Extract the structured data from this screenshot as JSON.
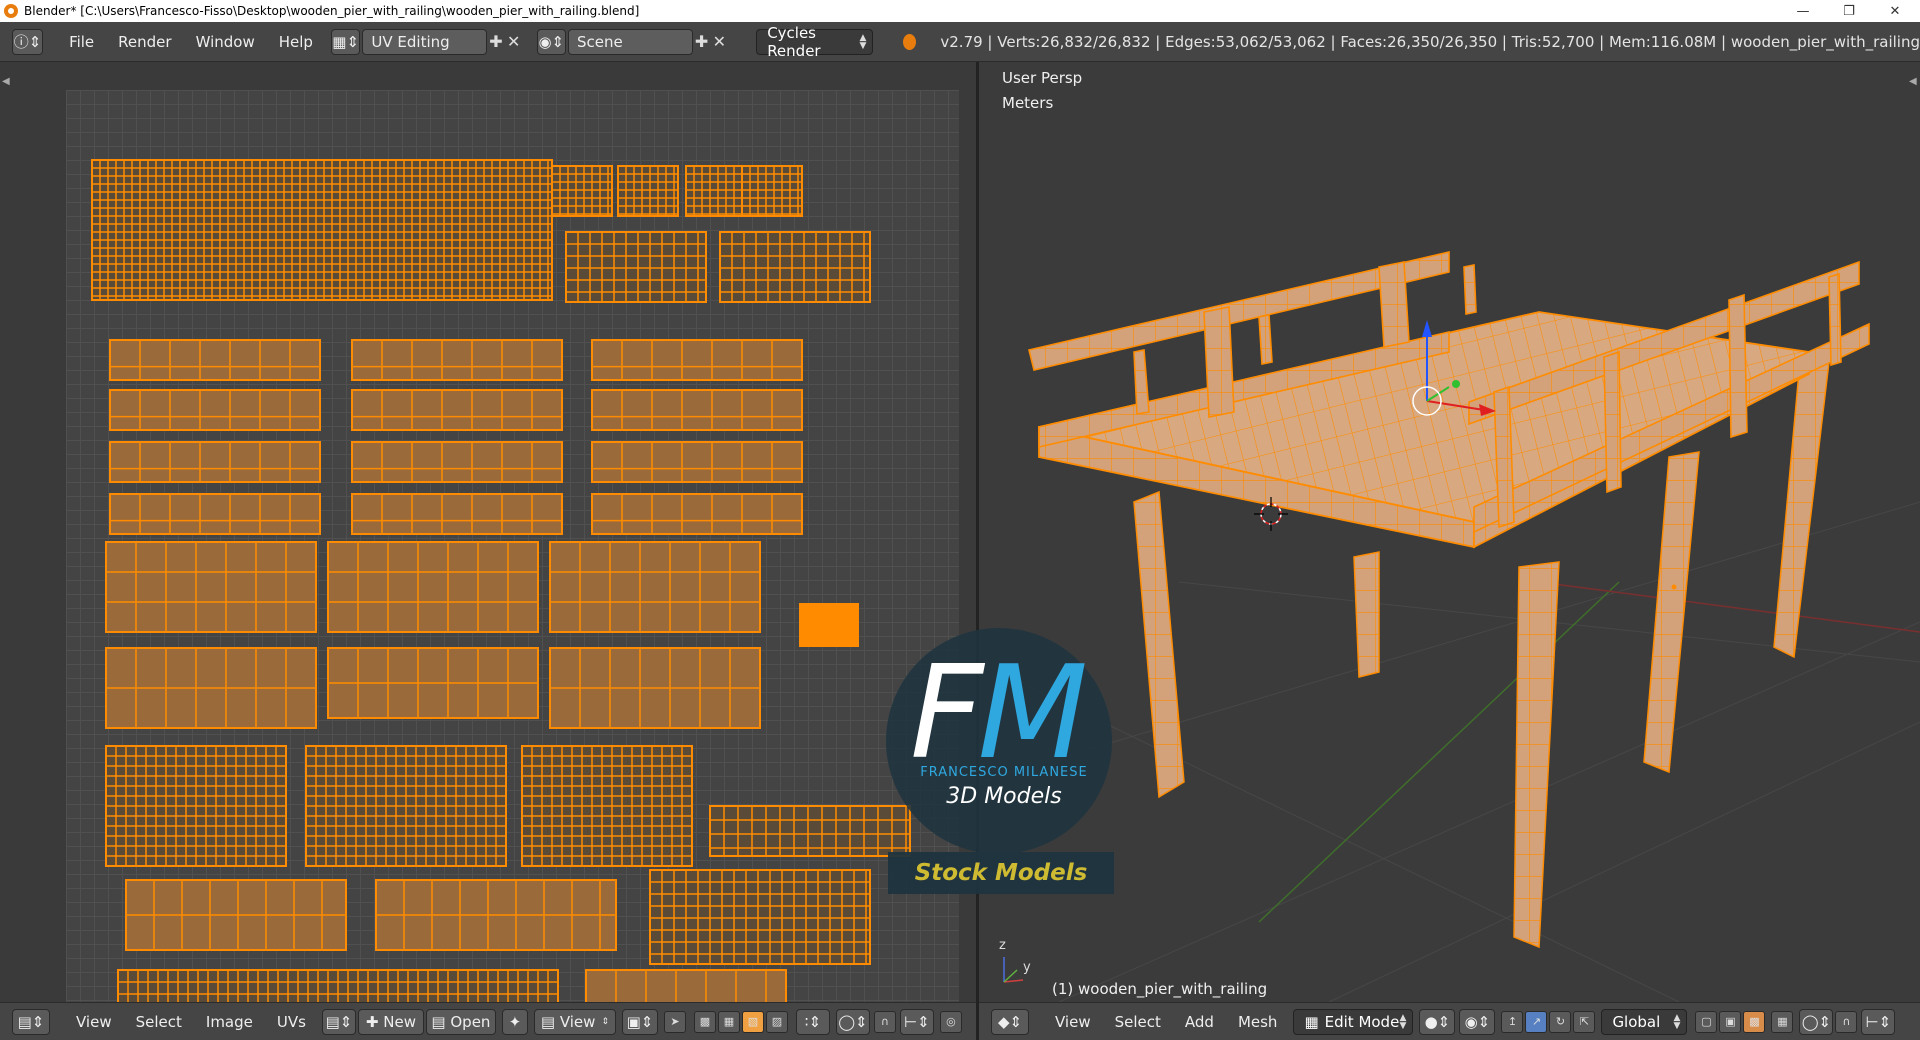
{
  "window": {
    "title": "Blender* [C:\\Users\\Francesco-Fisso\\Desktop\\wooden_pier_with_railing\\wooden_pier_with_railing.blend]",
    "min_icon": "minimize-icon",
    "max_icon": "restore-icon",
    "close_icon": "close-icon"
  },
  "infobar": {
    "menus": [
      "File",
      "Render",
      "Window",
      "Help"
    ],
    "screen_layout": "UV Editing",
    "scene": "Scene",
    "render_engine": "Cycles Render",
    "stats": "v2.79 | Verts:26,832/26,832 | Edges:53,062/53,062 | Faces:26,350/26,350 | Tris:52,700 | Mem:116.08M | wooden_pier_with_railing"
  },
  "viewport": {
    "view_name": "User Persp",
    "units": "Meters",
    "object_label": "(1) wooden_pier_with_railing",
    "axis_y": "y",
    "axis_z": "z"
  },
  "uv_footer": {
    "items": [
      "View",
      "Select",
      "Image",
      "UVs"
    ],
    "new": "New",
    "open": "Open",
    "view": "View"
  },
  "view3d_footer": {
    "items": [
      "View",
      "Select",
      "Add",
      "Mesh"
    ],
    "mode": "Edit Mode",
    "orientation": "Global"
  },
  "watermark": {
    "letter_f": "F",
    "letter_m": "M",
    "name": "FRANCESCO MILANESE",
    "sub": "3D Models",
    "stock": "Stock Models"
  },
  "colors": {
    "accent": "#ff8c00",
    "wood": "#d4a27a",
    "background": "#3b3b3b",
    "header": "#454545",
    "watermark_blue": "#2fa8e0",
    "watermark_gold": "#d6c232"
  }
}
